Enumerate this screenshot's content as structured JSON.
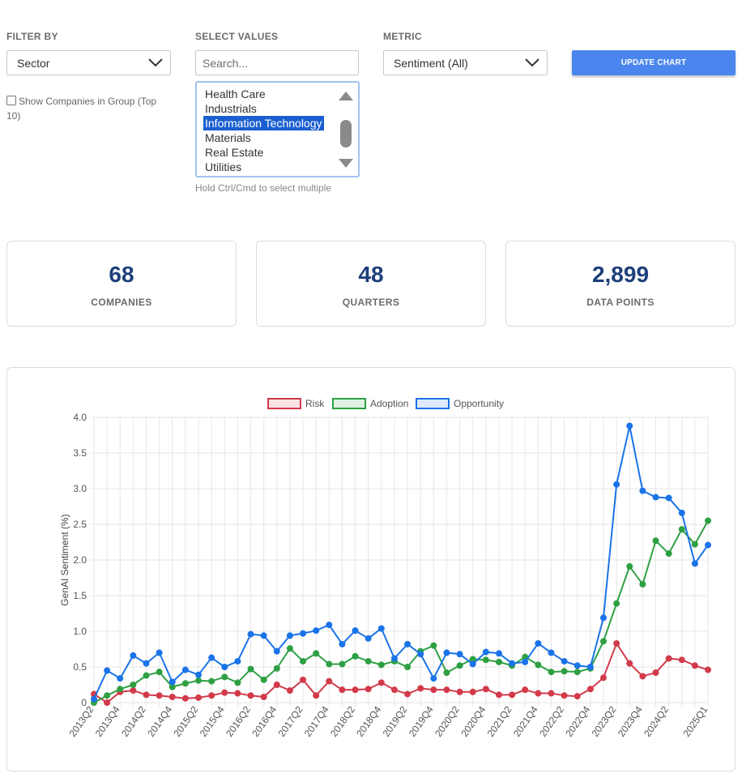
{
  "filters": {
    "filter_by": {
      "label": "FILTER BY",
      "value": "Sector"
    },
    "select_values": {
      "label": "SELECT VALUES",
      "search_placeholder": "Search...",
      "options": [
        "Health Care",
        "Industrials",
        "Information Technology",
        "Materials",
        "Real Estate",
        "Utilities"
      ],
      "selected": "Information Technology",
      "hint": "Hold Ctrl/Cmd to select multiple"
    },
    "metric": {
      "label": "METRIC",
      "value": "Sentiment (All)"
    },
    "update_button": "UPDATE CHART",
    "show_companies_label": "Show Companies in Group (Top 10)"
  },
  "stats": [
    {
      "value": "68",
      "label": "COMPANIES"
    },
    {
      "value": "48",
      "label": "QUARTERS"
    },
    {
      "value": "2,899",
      "label": "DATA POINTS"
    }
  ],
  "colors": {
    "risk": "#d23a4a",
    "adoption": "#2ea043",
    "opportunity": "#1a73e8",
    "accent": "#4a86ee",
    "stat_number": "#1d3f7a"
  },
  "chart_data": {
    "type": "line",
    "title": "",
    "xlabel": "",
    "ylabel": "GenAI Sentiment (%)",
    "ylim": [
      0,
      4.0
    ],
    "yticks": [
      "0",
      "0.5",
      "1.0",
      "1.5",
      "2.0",
      "2.5",
      "3.0",
      "3.5",
      "4.0"
    ],
    "x": [
      "2013Q2",
      "2013Q3",
      "2013Q4",
      "2014Q1",
      "2014Q2",
      "2014Q3",
      "2014Q4",
      "2015Q1",
      "2015Q2",
      "2015Q3",
      "2015Q4",
      "2016Q1",
      "2016Q2",
      "2016Q3",
      "2016Q4",
      "2017Q1",
      "2017Q2",
      "2017Q3",
      "2017Q4",
      "2018Q1",
      "2018Q2",
      "2018Q3",
      "2018Q4",
      "2019Q1",
      "2019Q2",
      "2019Q3",
      "2019Q4",
      "2020Q1",
      "2020Q2",
      "2020Q3",
      "2020Q4",
      "2021Q1",
      "2021Q2",
      "2021Q3",
      "2021Q4",
      "2022Q1",
      "2022Q2",
      "2022Q3",
      "2022Q4",
      "2023Q1",
      "2023Q2",
      "2023Q3",
      "2023Q4",
      "2024Q1",
      "2024Q2",
      "2024Q3",
      "2024Q4",
      "2025Q1"
    ],
    "xtick_labels": [
      "2013Q2",
      "2013Q4",
      "2014Q2",
      "2014Q4",
      "2015Q2",
      "2015Q4",
      "2016Q2",
      "2016Q4",
      "2017Q2",
      "2017Q4",
      "2018Q2",
      "2018Q4",
      "2019Q2",
      "2019Q4",
      "2020Q2",
      "2020Q4",
      "2021Q2",
      "2021Q4",
      "2022Q2",
      "2022Q4",
      "2023Q2",
      "2023Q4",
      "2024Q2",
      "2025Q1"
    ],
    "legend_position": "top",
    "grid": true,
    "series": [
      {
        "name": "Risk",
        "color": "#d23a4a",
        "values": [
          0.12,
          0.0,
          0.15,
          0.17,
          0.11,
          0.1,
          0.08,
          0.06,
          0.07,
          0.1,
          0.14,
          0.13,
          0.1,
          0.08,
          0.25,
          0.17,
          0.32,
          0.1,
          0.3,
          0.18,
          0.18,
          0.19,
          0.28,
          0.18,
          0.12,
          0.2,
          0.18,
          0.18,
          0.15,
          0.15,
          0.19,
          0.11,
          0.11,
          0.18,
          0.13,
          0.13,
          0.1,
          0.09,
          0.19,
          0.35,
          0.83,
          0.55,
          0.37,
          0.42,
          0.62,
          0.6,
          0.52,
          0.46
        ]
      },
      {
        "name": "Adoption",
        "color": "#2ea043",
        "values": [
          0.0,
          0.1,
          0.19,
          0.25,
          0.38,
          0.43,
          0.22,
          0.27,
          0.31,
          0.3,
          0.36,
          0.28,
          0.47,
          0.32,
          0.48,
          0.76,
          0.58,
          0.69,
          0.54,
          0.54,
          0.65,
          0.58,
          0.53,
          0.58,
          0.5,
          0.72,
          0.8,
          0.42,
          0.52,
          0.61,
          0.6,
          0.57,
          0.52,
          0.64,
          0.53,
          0.43,
          0.44,
          0.43,
          0.48,
          0.86,
          1.39,
          1.91,
          1.66,
          2.27,
          2.09,
          2.43,
          2.22,
          2.55
        ]
      },
      {
        "name": "Opportunity",
        "color": "#1a73e8",
        "values": [
          0.05,
          0.45,
          0.34,
          0.66,
          0.55,
          0.7,
          0.29,
          0.46,
          0.39,
          0.63,
          0.5,
          0.58,
          0.96,
          0.94,
          0.72,
          0.94,
          0.97,
          1.01,
          1.09,
          0.82,
          1.01,
          0.9,
          1.04,
          0.62,
          0.82,
          0.68,
          0.34,
          0.7,
          0.68,
          0.54,
          0.71,
          0.69,
          0.55,
          0.57,
          0.83,
          0.7,
          0.58,
          0.52,
          0.5,
          1.19,
          3.06,
          3.88,
          2.97,
          2.88,
          2.87,
          2.66,
          1.95,
          2.21
        ]
      }
    ]
  }
}
